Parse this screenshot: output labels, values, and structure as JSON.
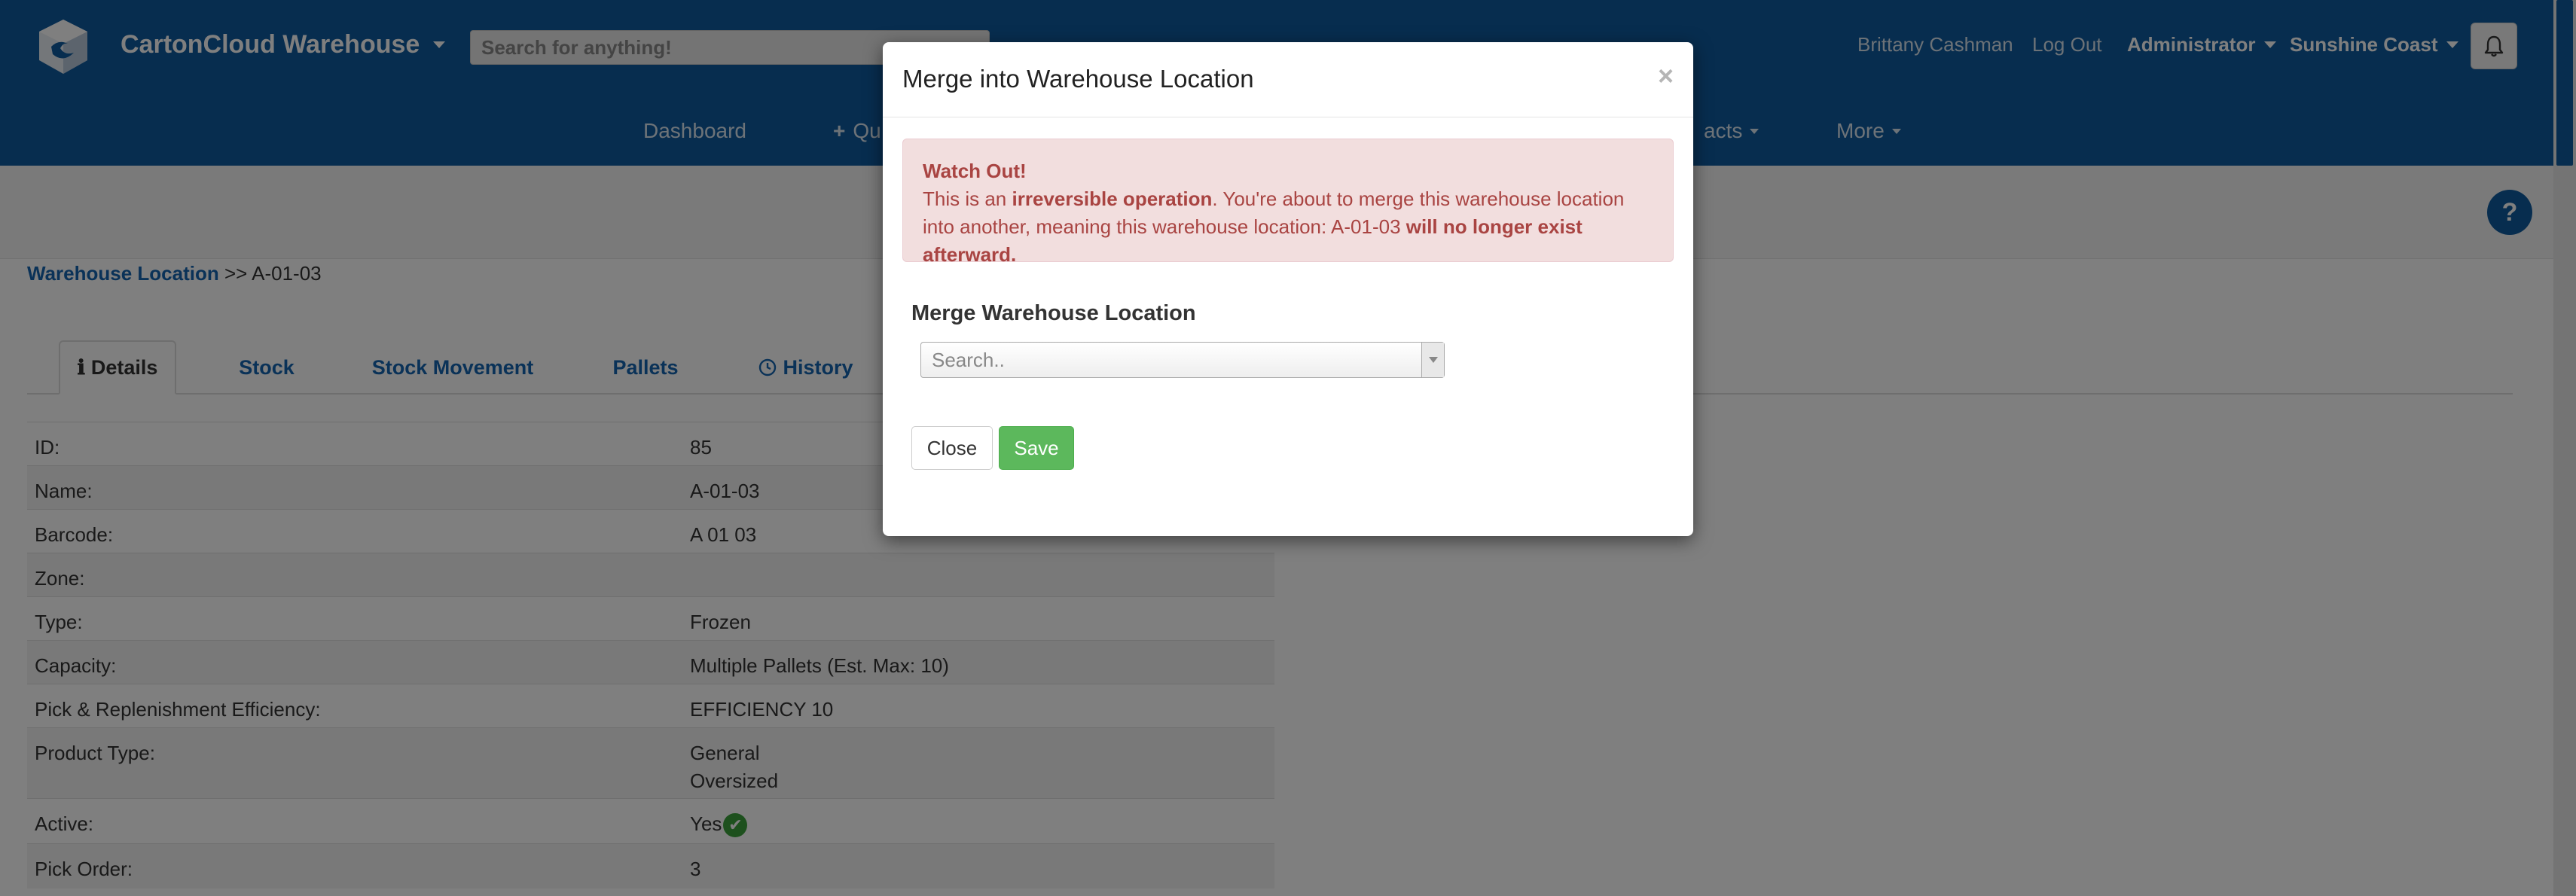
{
  "app": {
    "brand": "CartonCloud Warehouse",
    "search_placeholder": "Search for anything!"
  },
  "user_nav": {
    "user_name": "Brittany Cashman",
    "logout": "Log Out",
    "role": "Administrator",
    "location": "Sunshine Coast"
  },
  "main_nav": {
    "dashboard": "Dashboard",
    "quick_prefix": "+",
    "quick_partial": "Qu",
    "contacts_partial": "acts",
    "more": "More"
  },
  "breadcrumb": {
    "link": "Warehouse Location",
    "separator": ">>",
    "current": "A-01-03"
  },
  "tabs": [
    {
      "label": "Details",
      "icon": "info-icon",
      "active": true
    },
    {
      "label": "Stock"
    },
    {
      "label": "Stock Movement"
    },
    {
      "label": "Pallets"
    },
    {
      "label": "History",
      "icon": "clock-icon"
    }
  ],
  "details": {
    "id": {
      "label": "ID:",
      "value": "85"
    },
    "name": {
      "label": "Name:",
      "value": "A-01-03"
    },
    "barcode": {
      "label": "Barcode:",
      "value": "A 01 03"
    },
    "zone": {
      "label": "Zone:",
      "value": ""
    },
    "type": {
      "label": "Type:",
      "value": "Frozen"
    },
    "capacity": {
      "label": "Capacity:",
      "value": "Multiple Pallets (Est. Max: 10)"
    },
    "efficiency": {
      "label": "Pick & Replenishment Efficiency:",
      "value": "EFFICIENCY 10"
    },
    "product_type": {
      "label": "Product Type:",
      "value_1": "General",
      "value_2": "Oversized"
    },
    "active": {
      "label": "Active:",
      "value": "Yes"
    },
    "pick_order": {
      "label": "Pick Order:",
      "value": "3"
    }
  },
  "modal": {
    "title": "Merge into Warehouse Location",
    "close_symbol": "×",
    "alert": {
      "heading": "Watch Out!",
      "t1": "This is an ",
      "b1": "irreversible operation",
      "t2": ". You're about to merge this warehouse location into another, meaning this warehouse location: A-01-03 ",
      "b2": "will no longer exist afterward."
    },
    "field_label": "Merge Warehouse Location",
    "select_placeholder": "Search..",
    "close_button": "Close",
    "save_button": "Save"
  },
  "help_symbol": "?",
  "colors": {
    "header": "#0e5a9e",
    "link": "#1565b0",
    "alert_bg": "#f2dede",
    "alert_text": "#a94442",
    "save": "#5cb85c"
  }
}
